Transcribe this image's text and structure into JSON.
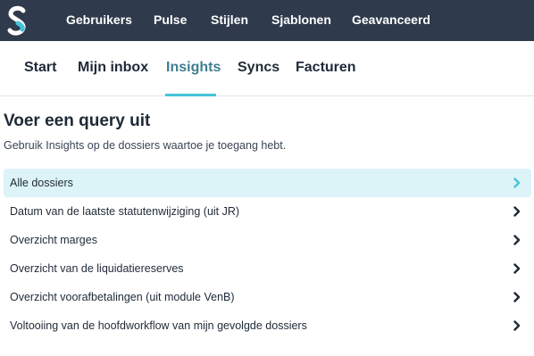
{
  "app": {
    "logo_icon": "s-logo-icon",
    "brand_color": "#46c3d9",
    "topbar_color": "#2f3b4c"
  },
  "topnav": [
    {
      "label": "Gebruikers"
    },
    {
      "label": "Pulse"
    },
    {
      "label": "Stijlen"
    },
    {
      "label": "Sjablonen"
    },
    {
      "label": "Geavanceerd"
    }
  ],
  "tabs": [
    {
      "label": "Start",
      "active": false
    },
    {
      "label": "Mijn inbox",
      "active": false
    },
    {
      "label": "Insights",
      "active": true
    },
    {
      "label": "Syncs",
      "active": false
    },
    {
      "label": "Facturen",
      "active": false
    }
  ],
  "main": {
    "title": "Voer een query uit",
    "subtitle": "Gebruik Insights op de dossiers waartoe je toegang hebt."
  },
  "queries": [
    {
      "label": "Alle dossiers",
      "selected": true,
      "icon": "chevron-right-icon"
    },
    {
      "label": "Datum van de laatste statutenwijziging (uit JR)",
      "selected": false,
      "icon": "chevron-right-icon"
    },
    {
      "label": "Overzicht marges",
      "selected": false,
      "icon": "chevron-right-icon"
    },
    {
      "label": "Overzicht van de liquidatiereserves",
      "selected": false,
      "icon": "chevron-right-icon"
    },
    {
      "label": "Overzicht voorafbetalingen (uit module VenB)",
      "selected": false,
      "icon": "chevron-right-icon"
    },
    {
      "label": "Voltooiing van de hoofdworkflow van mijn gevolgde dossiers",
      "selected": false,
      "icon": "chevron-right-icon"
    }
  ]
}
